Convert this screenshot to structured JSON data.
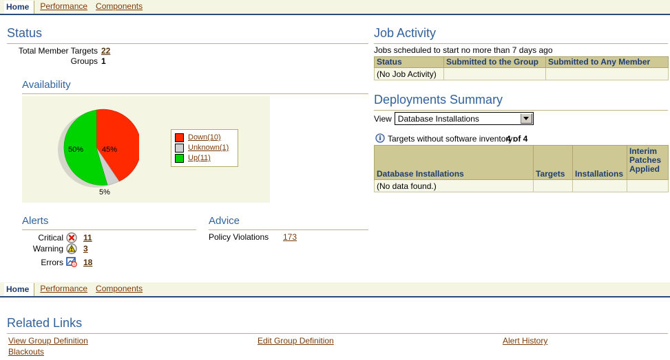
{
  "tabs_top": [
    {
      "label": "Home",
      "active": true
    },
    {
      "label": "Performance",
      "active": false
    },
    {
      "label": "Components",
      "active": false
    }
  ],
  "tabs_bottom": [
    {
      "label": "Home",
      "active": true
    },
    {
      "label": "Performance",
      "active": false
    },
    {
      "label": "Components",
      "active": false
    }
  ],
  "status": {
    "heading": "Status",
    "rows": [
      {
        "label": "Total Member Targets",
        "value": "22",
        "link": true
      },
      {
        "label": "Groups",
        "value": "1",
        "link": false
      }
    ]
  },
  "availability": {
    "heading": "Availability",
    "slice_labels": {
      "up": "50%",
      "down": "45%",
      "unknown": "5%"
    },
    "legend": [
      {
        "label": "Down(10)",
        "color": "#ff2a00"
      },
      {
        "label": "Unknown(1)",
        "color": "#d0d0d0"
      },
      {
        "label": "Up(11)",
        "color": "#00d400"
      }
    ]
  },
  "alerts": {
    "heading": "Alerts",
    "rows": [
      {
        "label": "Critical",
        "icon": "critical-icon",
        "value": "11"
      },
      {
        "label": "Warning",
        "icon": "warning-icon",
        "value": "3"
      },
      {
        "label": "Errors",
        "icon": "errors-icon",
        "value": "18"
      }
    ]
  },
  "advice": {
    "heading": "Advice",
    "label": "Policy Violations",
    "value": "173"
  },
  "job_activity": {
    "heading": "Job Activity",
    "subtitle": "Jobs scheduled to start no more than 7 days ago",
    "columns": [
      "Status",
      "Submitted to the Group",
      "Submitted to Any Member"
    ],
    "rows": [
      [
        "(No Job Activity)",
        "",
        ""
      ]
    ]
  },
  "deployments": {
    "heading": "Deployments Summary",
    "view_label": "View",
    "view_value": "Database Installations",
    "info_icon": "info-icon",
    "info_text_prefix": "Targets without software inventory:",
    "info_text_value": "4 of 4",
    "columns": [
      "Database Installations",
      "Targets",
      "Installations",
      "Interim Patches Applied"
    ],
    "rows": [
      [
        "(No data found.)",
        "",
        "",
        ""
      ]
    ]
  },
  "related_links": {
    "heading": "Related Links",
    "col1": [
      "View Group Definition",
      "Blackouts"
    ],
    "col2": [
      "Edit Group Definition"
    ],
    "col3": [
      "Alert History"
    ]
  },
  "chart_data": {
    "type": "pie",
    "title": "Availability",
    "categories": [
      "Down(10)",
      "Unknown(1)",
      "Up(11)"
    ],
    "values": [
      45,
      5,
      50
    ],
    "counts": [
      10,
      1,
      11
    ],
    "labels": [
      "45%",
      "5%",
      "50%"
    ],
    "colors": [
      "#ff2a00",
      "#d0d0d0",
      "#00d400"
    ],
    "legend_position": "right",
    "start_angle_deg": 0,
    "direction": "clockwise"
  }
}
